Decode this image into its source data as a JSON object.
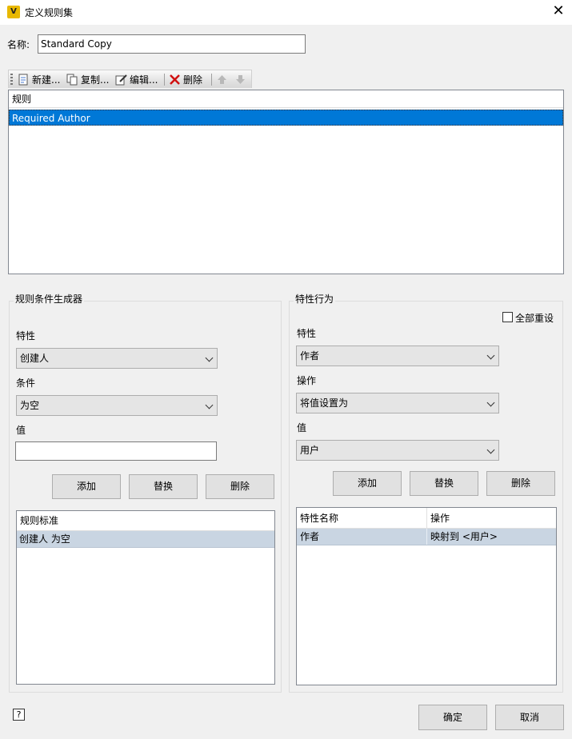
{
  "window": {
    "title": "定义规则集",
    "app_icon": "V"
  },
  "name_field": {
    "label": "名称:",
    "value": "Standard Copy"
  },
  "toolbar": {
    "new_label": "新建...",
    "copy_label": "复制...",
    "edit_label": "编辑...",
    "delete_label": "删除"
  },
  "rules_list": {
    "header": "规则",
    "items": [
      "Required Author"
    ]
  },
  "condition_builder": {
    "title": "规则条件生成器",
    "property_label": "特性",
    "property_value": "创建人",
    "condition_label": "条件",
    "condition_value": "为空",
    "value_label": "值",
    "value_text": "",
    "add_label": "添加",
    "replace_label": "替换",
    "delete_label": "删除",
    "criteria_header": "规则标准",
    "criteria_items": [
      "创建人 为空"
    ]
  },
  "property_behavior": {
    "title": "特性行为",
    "reset_all_label": "全部重设",
    "property_label": "特性",
    "property_value": "作者",
    "operation_label": "操作",
    "operation_value": "将值设置为",
    "value_label": "值",
    "value_value": "用户",
    "add_label": "添加",
    "replace_label": "替换",
    "delete_label": "删除",
    "columns": [
      "特性名称",
      "操作"
    ],
    "rows": [
      [
        "作者",
        "映射到 <用户>"
      ]
    ]
  },
  "footer": {
    "help_label": "?",
    "ok_label": "确定",
    "cancel_label": "取消"
  },
  "colors": {
    "selection": "#0078d7",
    "row_highlight": "#c9d5e2",
    "dialog_bg": "#f0f0f0"
  }
}
